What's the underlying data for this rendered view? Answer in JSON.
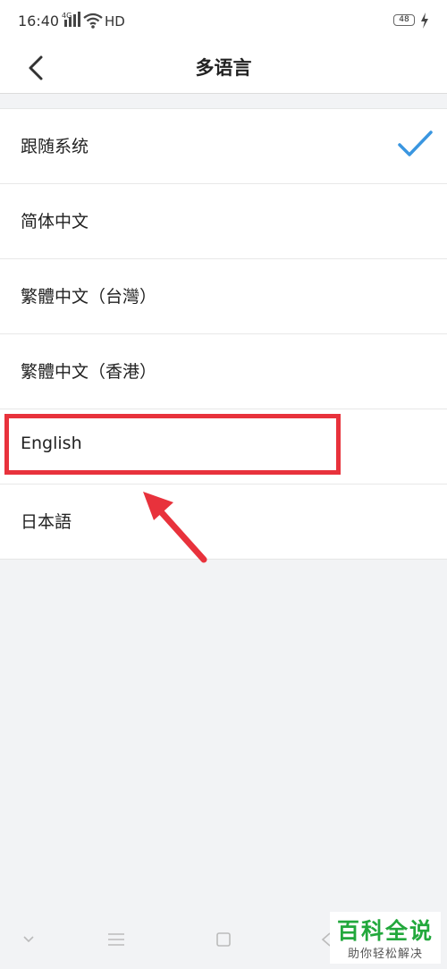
{
  "status_bar": {
    "time": "16:40",
    "network": "4G",
    "hd": "HD",
    "battery": "48"
  },
  "header": {
    "title": "多语言"
  },
  "languages": [
    {
      "label": "跟随系统",
      "selected": true
    },
    {
      "label": "简体中文",
      "selected": false
    },
    {
      "label": "繁體中文（台灣）",
      "selected": false
    },
    {
      "label": "繁體中文（香港）",
      "selected": false
    },
    {
      "label": "English",
      "selected": false
    },
    {
      "label": "日本語",
      "selected": false
    }
  ],
  "colors": {
    "accent": "#3a96e0",
    "annotation": "#e8323c",
    "watermark": "#22a83c"
  },
  "watermark": {
    "title": "百科全说",
    "subtitle": "助你轻松解决"
  }
}
